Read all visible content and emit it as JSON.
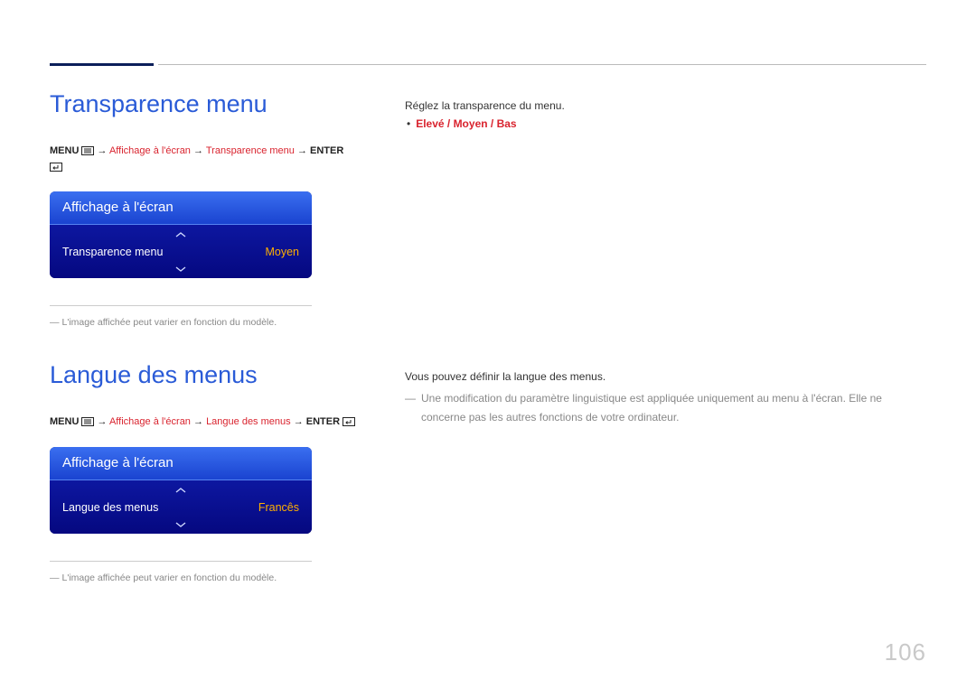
{
  "page_number": "106",
  "section1": {
    "title": "Transparence menu",
    "breadcrumb": {
      "menu_label": "MENU",
      "path1": "Affichage à l'écran",
      "path2": "Transparence menu",
      "enter_label": "ENTER"
    },
    "osd": {
      "header": "Affichage à l'écran",
      "row_label": "Transparence menu",
      "row_value": "Moyen"
    },
    "footnote": "L'image affichée peut varier en fonction du modèle.",
    "right": {
      "line1": "Réglez la transparence du menu.",
      "options": "Elevé / Moyen / Bas"
    }
  },
  "section2": {
    "title": "Langue des menus",
    "breadcrumb": {
      "menu_label": "MENU",
      "path1": "Affichage à l'écran",
      "path2": "Langue des menus",
      "enter_label": "ENTER"
    },
    "osd": {
      "header": "Affichage à l'écran",
      "row_label": "Langue des menus",
      "row_value": "Francês"
    },
    "footnote": "L'image affichée peut varier en fonction du modèle.",
    "right": {
      "line1": "Vous pouvez définir la langue des menus.",
      "note": "Une modification du paramètre linguistique est appliquée uniquement au menu à l'écran. Elle ne concerne pas les autres fonctions de votre ordinateur."
    }
  }
}
